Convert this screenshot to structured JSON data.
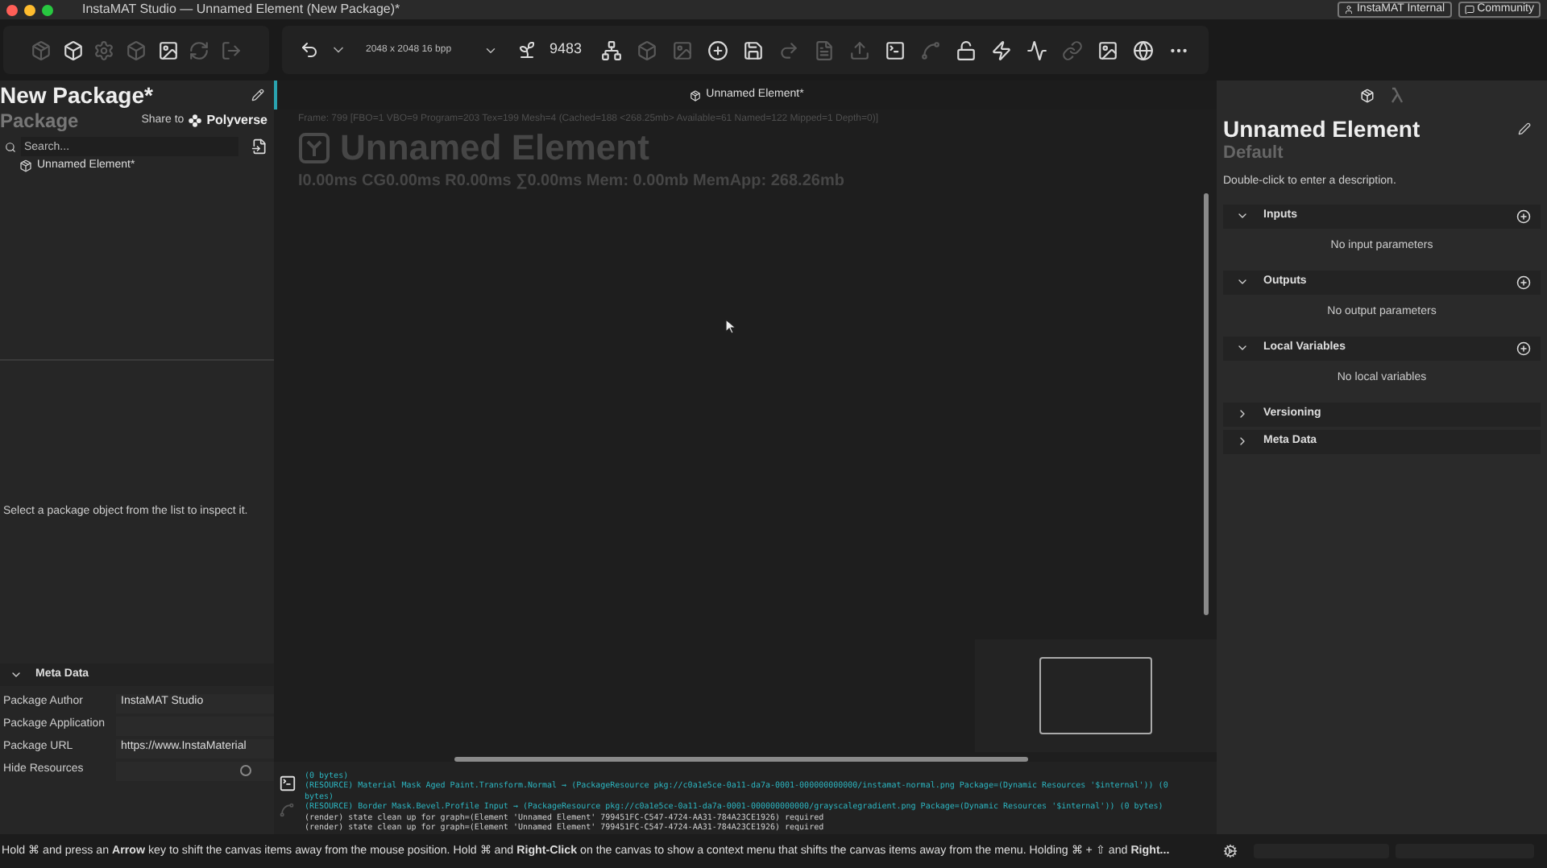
{
  "window": {
    "title": "InstaMAT Studio — Unnamed Element (New Package)*",
    "buttons": [
      {
        "kind": "user",
        "label": "InstaMAT Internal"
      },
      {
        "kind": "chat",
        "label": "Community"
      }
    ]
  },
  "left_toolbar": [
    {
      "kind": "package",
      "disabled": true
    },
    {
      "kind": "box",
      "disabled": false
    },
    {
      "kind": "gear",
      "disabled": true
    },
    {
      "kind": "cube",
      "disabled": true
    },
    {
      "kind": "image",
      "disabled": false
    },
    {
      "kind": "refresh",
      "disabled": true
    },
    {
      "kind": "export",
      "disabled": true
    }
  ],
  "main_toolbar": {
    "resolution": "2048 x 2048 16 bpp",
    "seed": "9483",
    "items": [
      {
        "kind": "graph",
        "disabled": false
      },
      {
        "kind": "cube",
        "disabled": true
      },
      {
        "kind": "image",
        "disabled": true
      },
      {
        "kind": "plus",
        "disabled": false
      },
      {
        "kind": "save",
        "disabled": false
      },
      {
        "kind": "redo",
        "disabled": true
      },
      {
        "kind": "doc",
        "disabled": true
      },
      {
        "kind": "upload",
        "disabled": true
      },
      {
        "kind": "terminal",
        "disabled": false
      },
      {
        "kind": "bezier",
        "disabled": true
      },
      {
        "kind": "unlock",
        "disabled": false
      },
      {
        "kind": "zap",
        "disabled": false
      },
      {
        "kind": "wave",
        "disabled": false
      },
      {
        "kind": "link",
        "disabled": true
      },
      {
        "kind": "image",
        "disabled": false
      },
      {
        "kind": "globe",
        "disabled": false
      },
      {
        "kind": "more",
        "disabled": false
      }
    ]
  },
  "package_panel": {
    "title": "New Package*",
    "subtitle": "Package",
    "share_label": "Share to",
    "share_target": "Polyverse",
    "search": {
      "placeholder": "Search..."
    },
    "items": [
      {
        "label": "Unnamed Element*",
        "selected": false
      }
    ],
    "hint": "Select a package object from the list to inspect it.",
    "meta_data": {
      "title": "Meta Data",
      "expanded": true,
      "fields": [
        {
          "kind": "text",
          "label": "Package Author",
          "value": "InstaMAT Studio"
        },
        {
          "kind": "text",
          "label": "Package Application"
        },
        {
          "kind": "text",
          "label": "Package URL",
          "value": "https://www.InstaMaterial"
        },
        {
          "kind": "toggle",
          "label": "Hide Resources",
          "checked": false
        }
      ]
    }
  },
  "canvas": {
    "tab_title": "Unnamed Element*",
    "stats": "Frame: 799 [FBO=1 VBO=9 Program=203 Tex=199 Mesh=4 (Cached=188 <268.25mb> Available=61 Named=122 Mipped=1 Depth=0)]",
    "overlay_title": "Unnamed Element",
    "timings": "I0.00ms CG0.00ms R0.00ms ∑0.00ms Mem: 0.00mb MemApp: 268.26mb"
  },
  "log": [
    {
      "kind": "resource",
      "text": "(0 bytes)"
    },
    {
      "kind": "resource",
      "text": "(RESOURCE) Material Mask Aged Paint.Transform.Normal → (PackageResource pkg://c0a1e5ce-0a11-da7a-0001-000000000000/instamat-normal.png Package=(Dynamic Resources '$internal')) (0"
    },
    {
      "kind": "resource",
      "text": "bytes)"
    },
    {
      "kind": "resource",
      "text": "(RESOURCE) Border Mask.Bevel.Profile Input → (PackageResource pkg://c0a1e5ce-0a11-da7a-0001-000000000000/grayscalegradient.png Package=(Dynamic Resources '$internal')) (0 bytes)"
    },
    {
      "kind": "render",
      "text": "(render) state clean up for graph=(Element 'Unnamed Element' 799451FC-C547-4724-AA31-784A23CE1926) required"
    },
    {
      "kind": "render",
      "text": "(render) state clean up for graph=(Element 'Unnamed Element' 799451FC-C547-4724-AA31-784A23CE1926) required"
    }
  ],
  "inspector": {
    "title": "Unnamed Element",
    "subtitle": "Default",
    "description": "Double-click to enter a description.",
    "sections": [
      {
        "title": "Inputs",
        "expanded": true,
        "addable": true,
        "empty_text": "No input parameters"
      },
      {
        "title": "Outputs",
        "expanded": true,
        "addable": true,
        "empty_text": "No output parameters"
      },
      {
        "title": "Local Variables",
        "expanded": true,
        "addable": true,
        "empty_text": "No local variables"
      },
      {
        "title": "Versioning",
        "expanded": false,
        "addable": false
      },
      {
        "title": "Meta Data",
        "expanded": false,
        "addable": false
      }
    ]
  },
  "status_bar": {
    "hint": "Hold ⌘ and press an **Arrow** key to shift the canvas items away from the mouse position. Hold ⌘ and **Right-Click** on the canvas to show a context menu that shifts the canvas items away from the menu. Holding ⌘ + ⇧ and **Right...**"
  }
}
